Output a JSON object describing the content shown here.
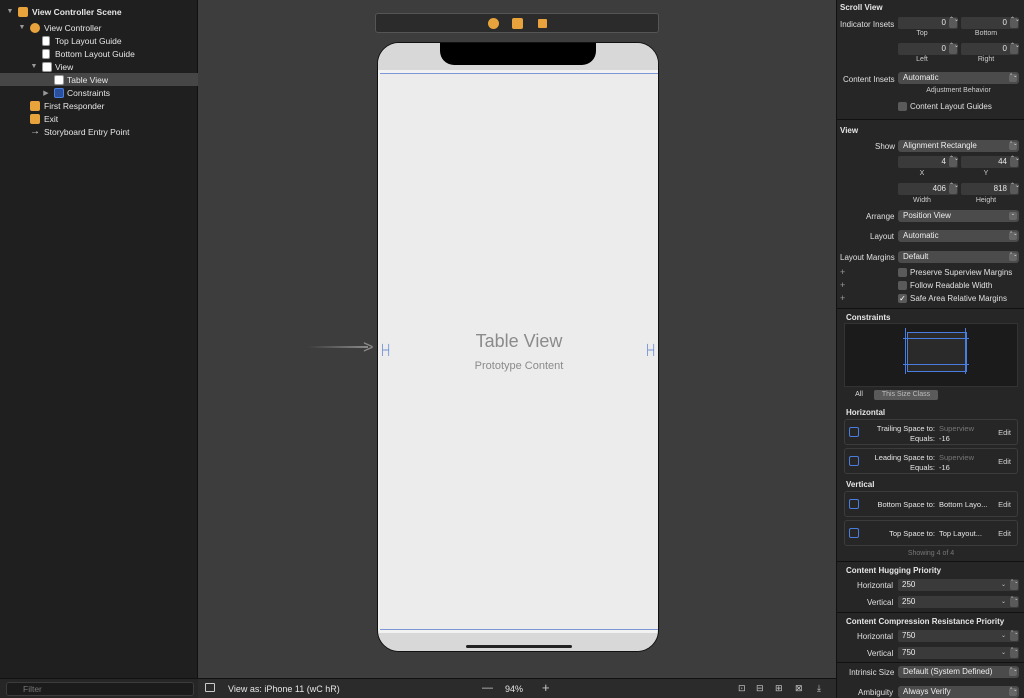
{
  "outline": {
    "items": [
      {
        "label": "View Controller Scene",
        "bold": true
      },
      {
        "label": "View Controller"
      },
      {
        "label": "Top Layout Guide"
      },
      {
        "label": "Bottom Layout Guide"
      },
      {
        "label": "View"
      },
      {
        "label": "Table View"
      },
      {
        "label": "Constraints"
      },
      {
        "label": "First Responder"
      },
      {
        "label": "Exit"
      },
      {
        "label": "Storyboard Entry Point"
      }
    ],
    "filter_placeholder": "Filter"
  },
  "canvas": {
    "table_view_title": "Table View",
    "table_view_subtitle": "Prototype Content",
    "view_as": "View as: iPhone 11 (",
    "view_as_suffix": "wC hR)",
    "zoom": "94%"
  },
  "inspector": {
    "scroll_view": {
      "header": "Scroll View",
      "indicator_insets_label": "Indicator Insets",
      "top": "0",
      "top_label": "Top",
      "bottom": "0",
      "bottom_label": "Bottom",
      "left": "0",
      "left_label": "Left",
      "right": "0",
      "right_label": "Right",
      "content_insets_label": "Content Insets",
      "content_insets_value": "Automatic",
      "adjustment_behavior": "Adjustment Behavior",
      "content_layout_guides": "Content Layout Guides"
    },
    "view": {
      "header": "View",
      "show_label": "Show",
      "show_value": "Alignment Rectangle",
      "x": "4",
      "x_label": "X",
      "y": "44",
      "y_label": "Y",
      "width": "406",
      "width_label": "Width",
      "height": "818",
      "height_label": "Height",
      "arrange_label": "Arrange",
      "arrange_value": "Position View",
      "layout_label": "Layout",
      "layout_value": "Automatic",
      "layout_margins_label": "Layout Margins",
      "layout_margins_value": "Default",
      "preserve_superview_margins": "Preserve Superview Margins",
      "follow_readable_width": "Follow Readable Width",
      "safe_area_relative_margins": "Safe Area Relative Margins"
    },
    "constraints": {
      "header": "Constraints",
      "seg_all": "All",
      "seg_size_class": "This Size Class",
      "horizontal_header": "Horizontal",
      "trailing_label": "Trailing Space to:",
      "trailing_target": "Superview",
      "trailing_equals_label": "Equals:",
      "trailing_equals": "-16",
      "leading_label": "Leading Space to:",
      "leading_target": "Superview",
      "leading_equals_label": "Equals:",
      "leading_equals": "-16",
      "vertical_header": "Vertical",
      "bottom_label": "Bottom Space to:",
      "bottom_target": "Bottom Layo...",
      "top_label": "Top Space to:",
      "top_target": "Top Layout...",
      "edit": "Edit",
      "showing": "Showing 4 of 4"
    },
    "hugging": {
      "header": "Content Hugging Priority",
      "horizontal_label": "Horizontal",
      "horizontal": "250",
      "vertical_label": "Vertical",
      "vertical": "250"
    },
    "compression": {
      "header": "Content Compression Resistance Priority",
      "horizontal_label": "Horizontal",
      "horizontal": "750",
      "vertical_label": "Vertical",
      "vertical": "750"
    },
    "intrinsic_size_label": "Intrinsic Size",
    "intrinsic_size_value": "Default (System Defined)",
    "ambiguity_label": "Ambiguity",
    "ambiguity_value": "Always Verify"
  },
  "colors": {
    "accent": "#4a7de0",
    "icon_orange": "#e8a33c",
    "selection": "#464646"
  }
}
